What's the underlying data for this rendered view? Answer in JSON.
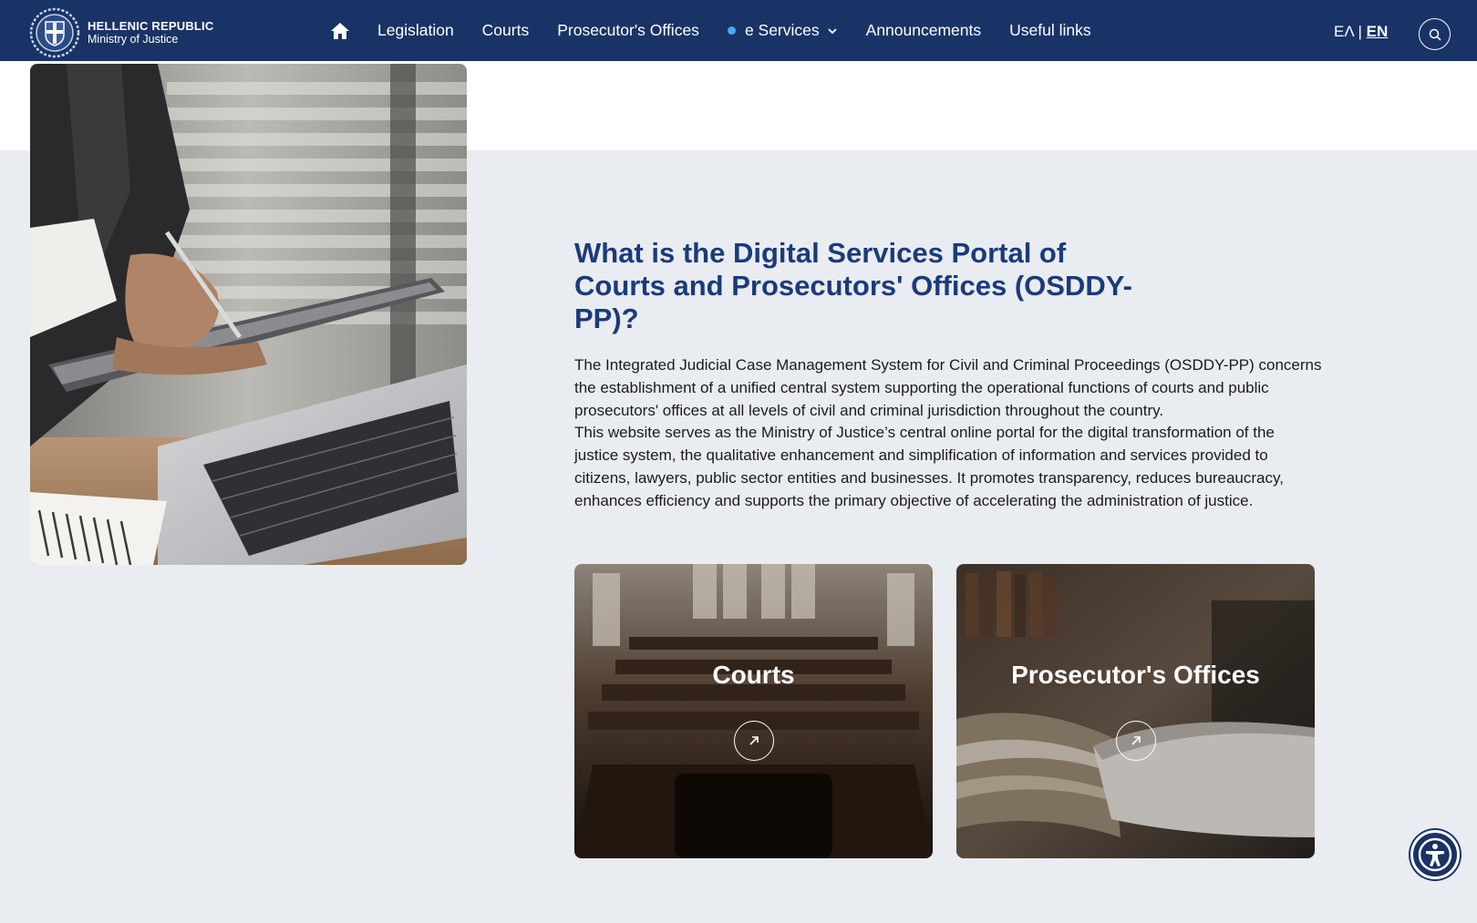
{
  "header": {
    "logo_line1": "HELLENIC REPUBLIC",
    "logo_line2": "Ministry of Justice",
    "home_icon": "home-icon",
    "nav": [
      {
        "label": "Legislation"
      },
      {
        "label": "Courts"
      },
      {
        "label": "Prosecutor's Offices"
      },
      {
        "label": "e Services",
        "has_dropdown": true
      },
      {
        "label": "Announcements"
      },
      {
        "label": "Useful links"
      }
    ],
    "lang_el": "ΕΛ",
    "lang_sep": "|",
    "lang_en": "EN",
    "search_icon": "search-icon"
  },
  "main": {
    "title": "What is the Digital Services Portal of Courts and Prosecutors' Offices (OSDDY-PP)?",
    "paragraph1": "The Integrated Judicial Case Management System for Civil and Criminal Proceedings (OSDDY-PP) concerns the establishment of a unified central system supporting the operational functions of courts and public prosecutors' offices at all levels of civil and criminal jurisdiction throughout the country.",
    "paragraph2": "This website serves as the Ministry of Justice’s central online portal for the digital transformation of the justice system, the qualitative enhancement and simplification of information and services provided to citizens, lawyers, public sector entities and businesses. It promotes transparency, reduces bureaucracy, enhances efficiency and supports the primary objective of accelerating the administration of justice.",
    "cards": [
      {
        "title": "Courts",
        "icon": "arrow-up-right-icon"
      },
      {
        "title": "Prosecutor's Offices",
        "icon": "arrow-up-right-icon"
      }
    ]
  },
  "accessibility_icon": "accessibility-icon",
  "colors": {
    "header_bg": "#1a3366",
    "title": "#1a3b7a",
    "page_bg": "#e9ecf1",
    "accent_dot": "#4aa8ef"
  }
}
